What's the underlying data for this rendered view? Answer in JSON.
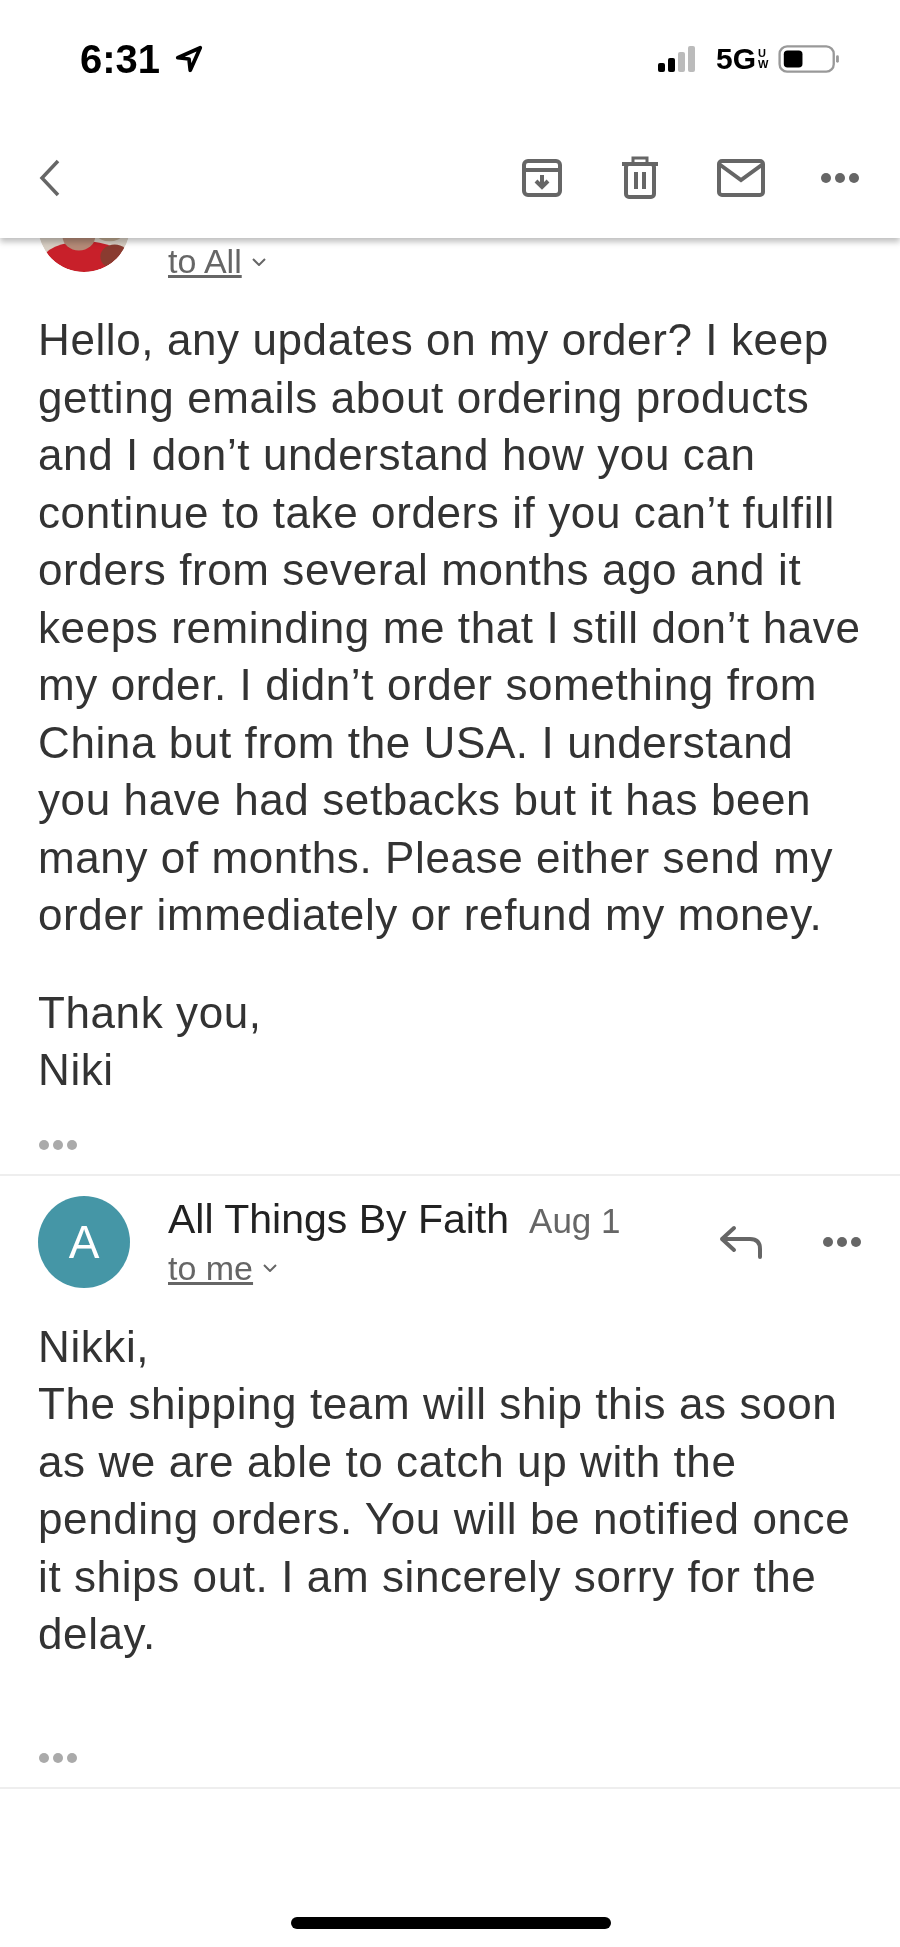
{
  "status_bar": {
    "time": "6:31",
    "network": "5G",
    "network_suffix": "UW"
  },
  "toolbar": {
    "actions": [
      {
        "kind": "archive"
      },
      {
        "kind": "delete"
      },
      {
        "kind": "unread"
      },
      {
        "kind": "more"
      }
    ]
  },
  "messages": [
    {
      "recipients": "to All",
      "paragraphs": [
        "Hello, any updates on my order? I keep getting emails about ordering products and I don’t understand how you can continue to take orders if you can’t fulfill orders from several months ago and it keeps reminding me that I still don’t have my order. I didn’t order something from China but from the USA. I understand you have had setbacks but it has been many of months. Please either send my order immediately or refund my money.",
        "Thank you,\nNiki"
      ]
    },
    {
      "avatar": {
        "kind": "letter",
        "letter": "A",
        "color": "#4596a6"
      },
      "sender": "All Things By Faith",
      "date": "Aug 1",
      "recipients": "to me",
      "paragraphs": [
        "Nikki,\nThe shipping team will ship this as soon as we are able to catch up with the pending orders. You will be notified once it ships out. I am sincerely sorry for the delay."
      ]
    }
  ]
}
